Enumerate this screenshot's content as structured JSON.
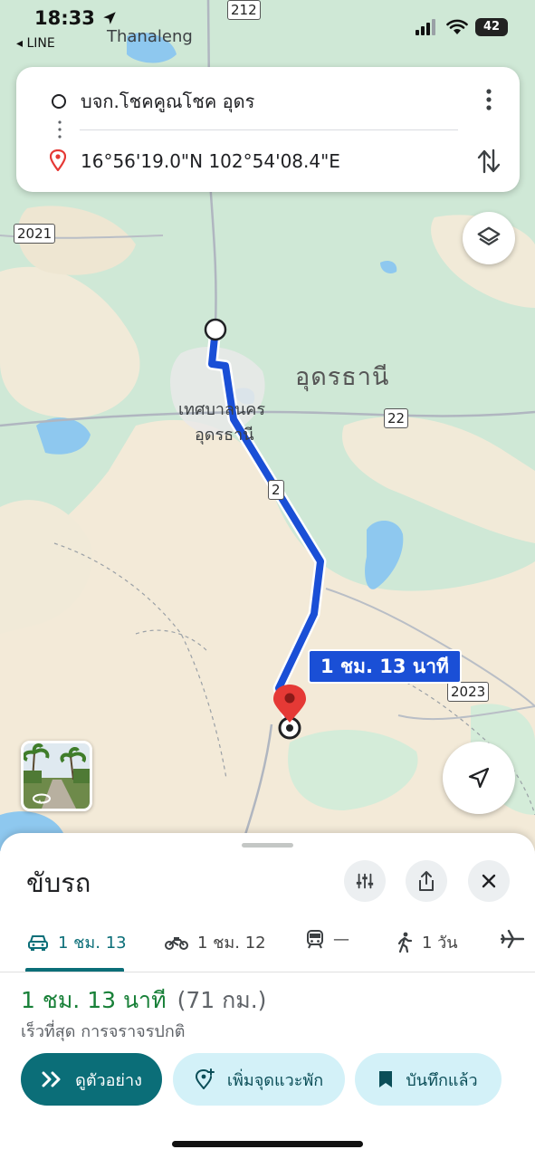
{
  "status_bar": {
    "time": "18:33",
    "back_app": "◂ LINE",
    "battery": "42"
  },
  "search": {
    "origin": "บจก.โชคคูณโชค อุดร",
    "destination": "16°56'19.0\"N 102°54'08.4\"E"
  },
  "map": {
    "place_labels": {
      "thanaleng": "Thanaleng",
      "province": "อุดรธานี",
      "city_line1": "เทศบาลนคร",
      "city_line2": "อุดรธานี"
    },
    "route_shields": {
      "r212": "212",
      "r2021": "2021",
      "r22": "22",
      "r2": "2",
      "r2023": "2023"
    },
    "route_label": "1 ชม. 13 นาที",
    "colors": {
      "route": "#1a4fd6",
      "land_green": "#cfe8d6",
      "land_beige": "#f3ead8",
      "water": "#8ec8ef",
      "destination_pin": "#e53935"
    }
  },
  "sheet": {
    "title": "ขับรถ",
    "modes": [
      {
        "icon": "car-icon",
        "label": "1 ชม. 13"
      },
      {
        "icon": "motorcycle-icon",
        "label": "1 ชม. 12"
      },
      {
        "icon": "transit-icon",
        "label": "—"
      },
      {
        "icon": "walking-icon",
        "label": "1 วัน"
      },
      {
        "icon": "flight-icon",
        "label": ""
      }
    ],
    "duration": "1 ชม. 13 นาที",
    "distance": "(71 กม.)",
    "subtitle": "เร็วที่สุด การจราจรปกติ",
    "buttons": {
      "preview": "ดูตัวอย่าง",
      "add_stop": "เพิ่มจุดแวะพัก",
      "saved": "บันทึกแล้ว"
    }
  }
}
